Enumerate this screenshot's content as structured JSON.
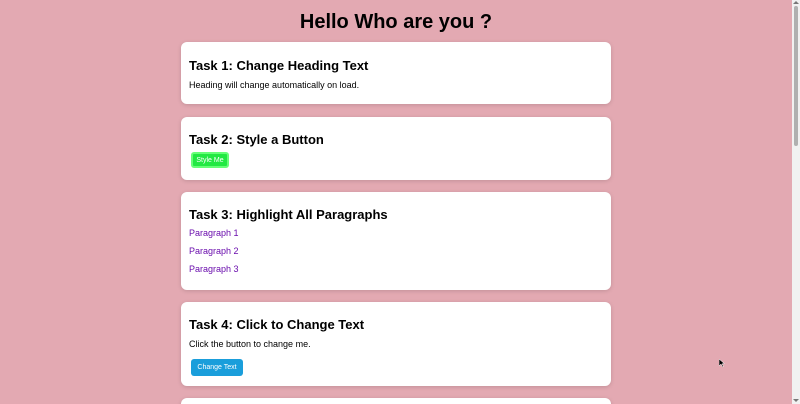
{
  "heading": "Hello Who are you ?",
  "task1": {
    "title": "Task 1: Change Heading Text",
    "text": "Heading will change automatically on load."
  },
  "task2": {
    "title": "Task 2: Style a Button",
    "button_label": "Style Me"
  },
  "task3": {
    "title": "Task 3: Highlight All Paragraphs",
    "paragraphs": [
      "Paragraph 1",
      "Paragraph 2",
      "Paragraph 3"
    ]
  },
  "task4": {
    "title": "Task 4: Click to Change Text",
    "text": "Click the button to change me.",
    "button_label": "Change Text"
  },
  "colors": {
    "background": "#e3a9b2",
    "paragraph_highlight": "#6a0dad",
    "style_button": "#22e843",
    "change_button": "#1a9edb"
  }
}
